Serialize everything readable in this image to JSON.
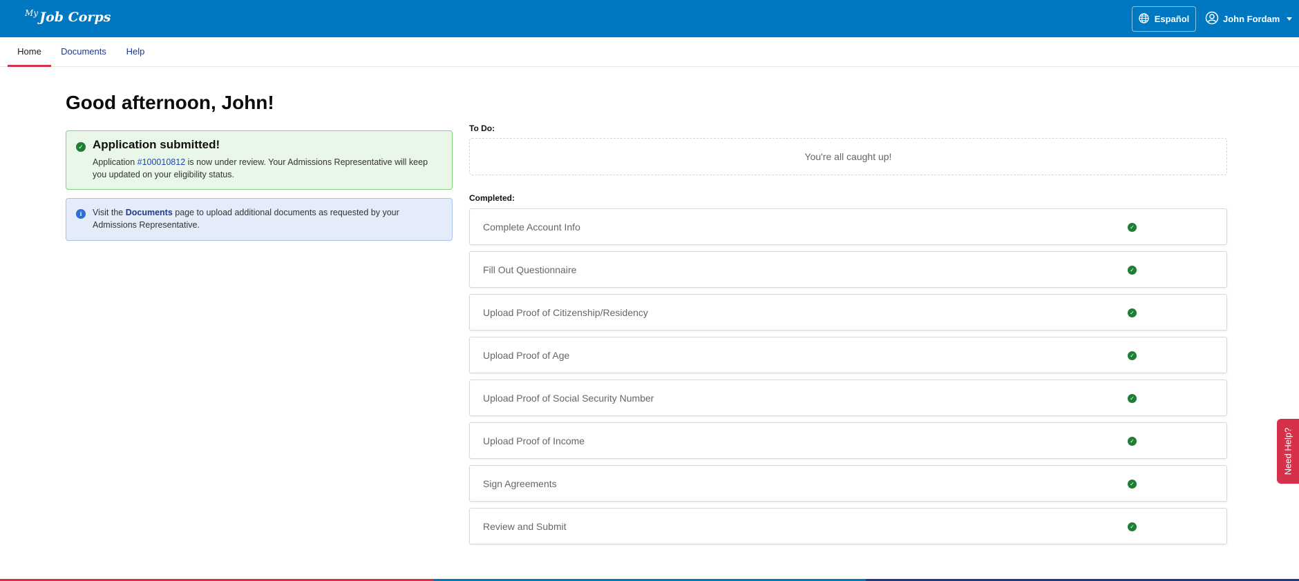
{
  "header": {
    "logo_text": "Job Corps",
    "logo_mark": "My",
    "language_button": "Español",
    "user_name": "John Fordam"
  },
  "nav": {
    "tabs": [
      {
        "label": "Home",
        "active": true
      },
      {
        "label": "Documents",
        "active": false
      },
      {
        "label": "Help",
        "active": false
      }
    ]
  },
  "main": {
    "greeting": "Good afternoon, John!",
    "success_alert": {
      "title": "Application submitted!",
      "body_prefix": "Application ",
      "application_number": "#100010812",
      "body_suffix": " is now under review. Your Admissions Representative will keep you updated on your eligibility status."
    },
    "info_alert": {
      "prefix": "Visit the ",
      "link_text": "Documents",
      "suffix": " page to upload additional documents as requested by your Admissions Representative."
    }
  },
  "tasks": {
    "todo_label": "To Do:",
    "todo_empty": "You're all caught up!",
    "completed_label": "Completed:",
    "completed": [
      "Complete Account Info",
      "Fill Out Questionnaire",
      "Upload Proof of Citizenship/Residency",
      "Upload Proof of Age",
      "Upload Proof of Social Security Number",
      "Upload Proof of Income",
      "Sign Agreements",
      "Review and Submit"
    ]
  },
  "need_help": "Need Help?",
  "icons": {
    "language": "globe-icon",
    "user": "user-circle-icon",
    "user_dropdown": "caret-down-icon",
    "success": "check-circle-icon",
    "info": "info-circle-icon",
    "task_complete": "check-circle-icon"
  },
  "colors": {
    "header_bg": "#0078c1",
    "active_tab_underline": "#d6304a",
    "success_bg": "#e8f7e8",
    "success_border": "#7fd17f",
    "info_bg": "#e4ecf9",
    "info_border": "#a9c1ea",
    "check_green": "#1e7e34",
    "need_help_bg": "#d6304a",
    "footer_stripe": [
      "#d6304a",
      "#0078c1",
      "#1f3a8a"
    ]
  }
}
